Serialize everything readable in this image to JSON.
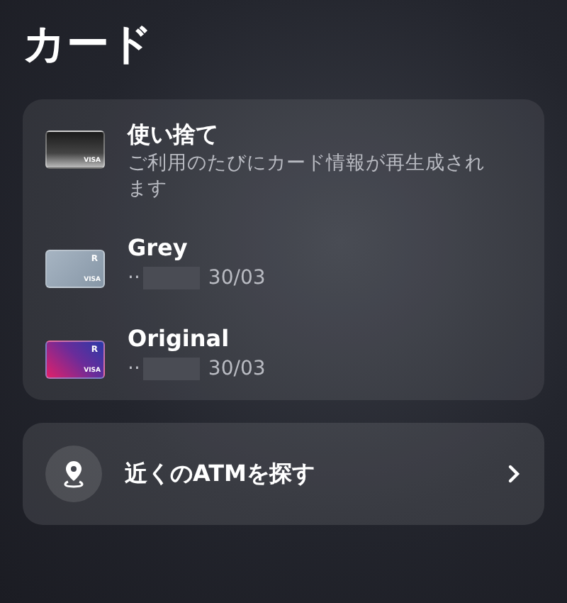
{
  "title": "カード",
  "cards": [
    {
      "kind": "black",
      "name": "使い捨て",
      "description": "ご利用のたびにカード情報が再生成されます",
      "network": "VISA"
    },
    {
      "kind": "grey",
      "name": "Grey",
      "mask": "··",
      "expiry": "30/03",
      "brand": "R",
      "network": "VISA"
    },
    {
      "kind": "gradient",
      "name": "Original",
      "mask": "··",
      "expiry": "30/03",
      "brand": "R",
      "network": "VISA"
    }
  ],
  "atm": {
    "label": "近くのATMを探す"
  }
}
